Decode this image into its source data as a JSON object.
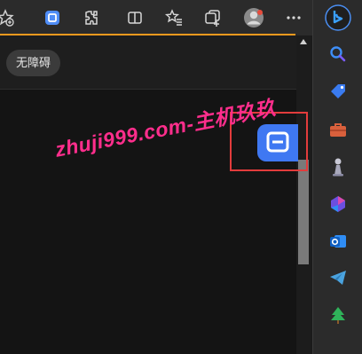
{
  "toolbar": {
    "icons": [
      "read-aloud-icon",
      "app-icon",
      "extensions-icon",
      "split-screen-icon",
      "favorites-icon",
      "collections-icon",
      "profile-icon",
      "settings-menu-icon"
    ]
  },
  "page": {
    "accessibility_button": "无障碍"
  },
  "watermark": "zhuji999.com-主机玖玖",
  "sidebar": {
    "items": [
      "bing-copilot-icon",
      "search-icon",
      "shopping-icon",
      "tools-icon",
      "games-icon",
      "microsoft-365-icon",
      "outlook-icon",
      "telegram-icon",
      "tree-icon"
    ]
  },
  "colors": {
    "accent": "#f39a1e",
    "highlight": "#e23c3c",
    "watermark": "#ff2e8c",
    "app_blue": "#3f78f2"
  }
}
